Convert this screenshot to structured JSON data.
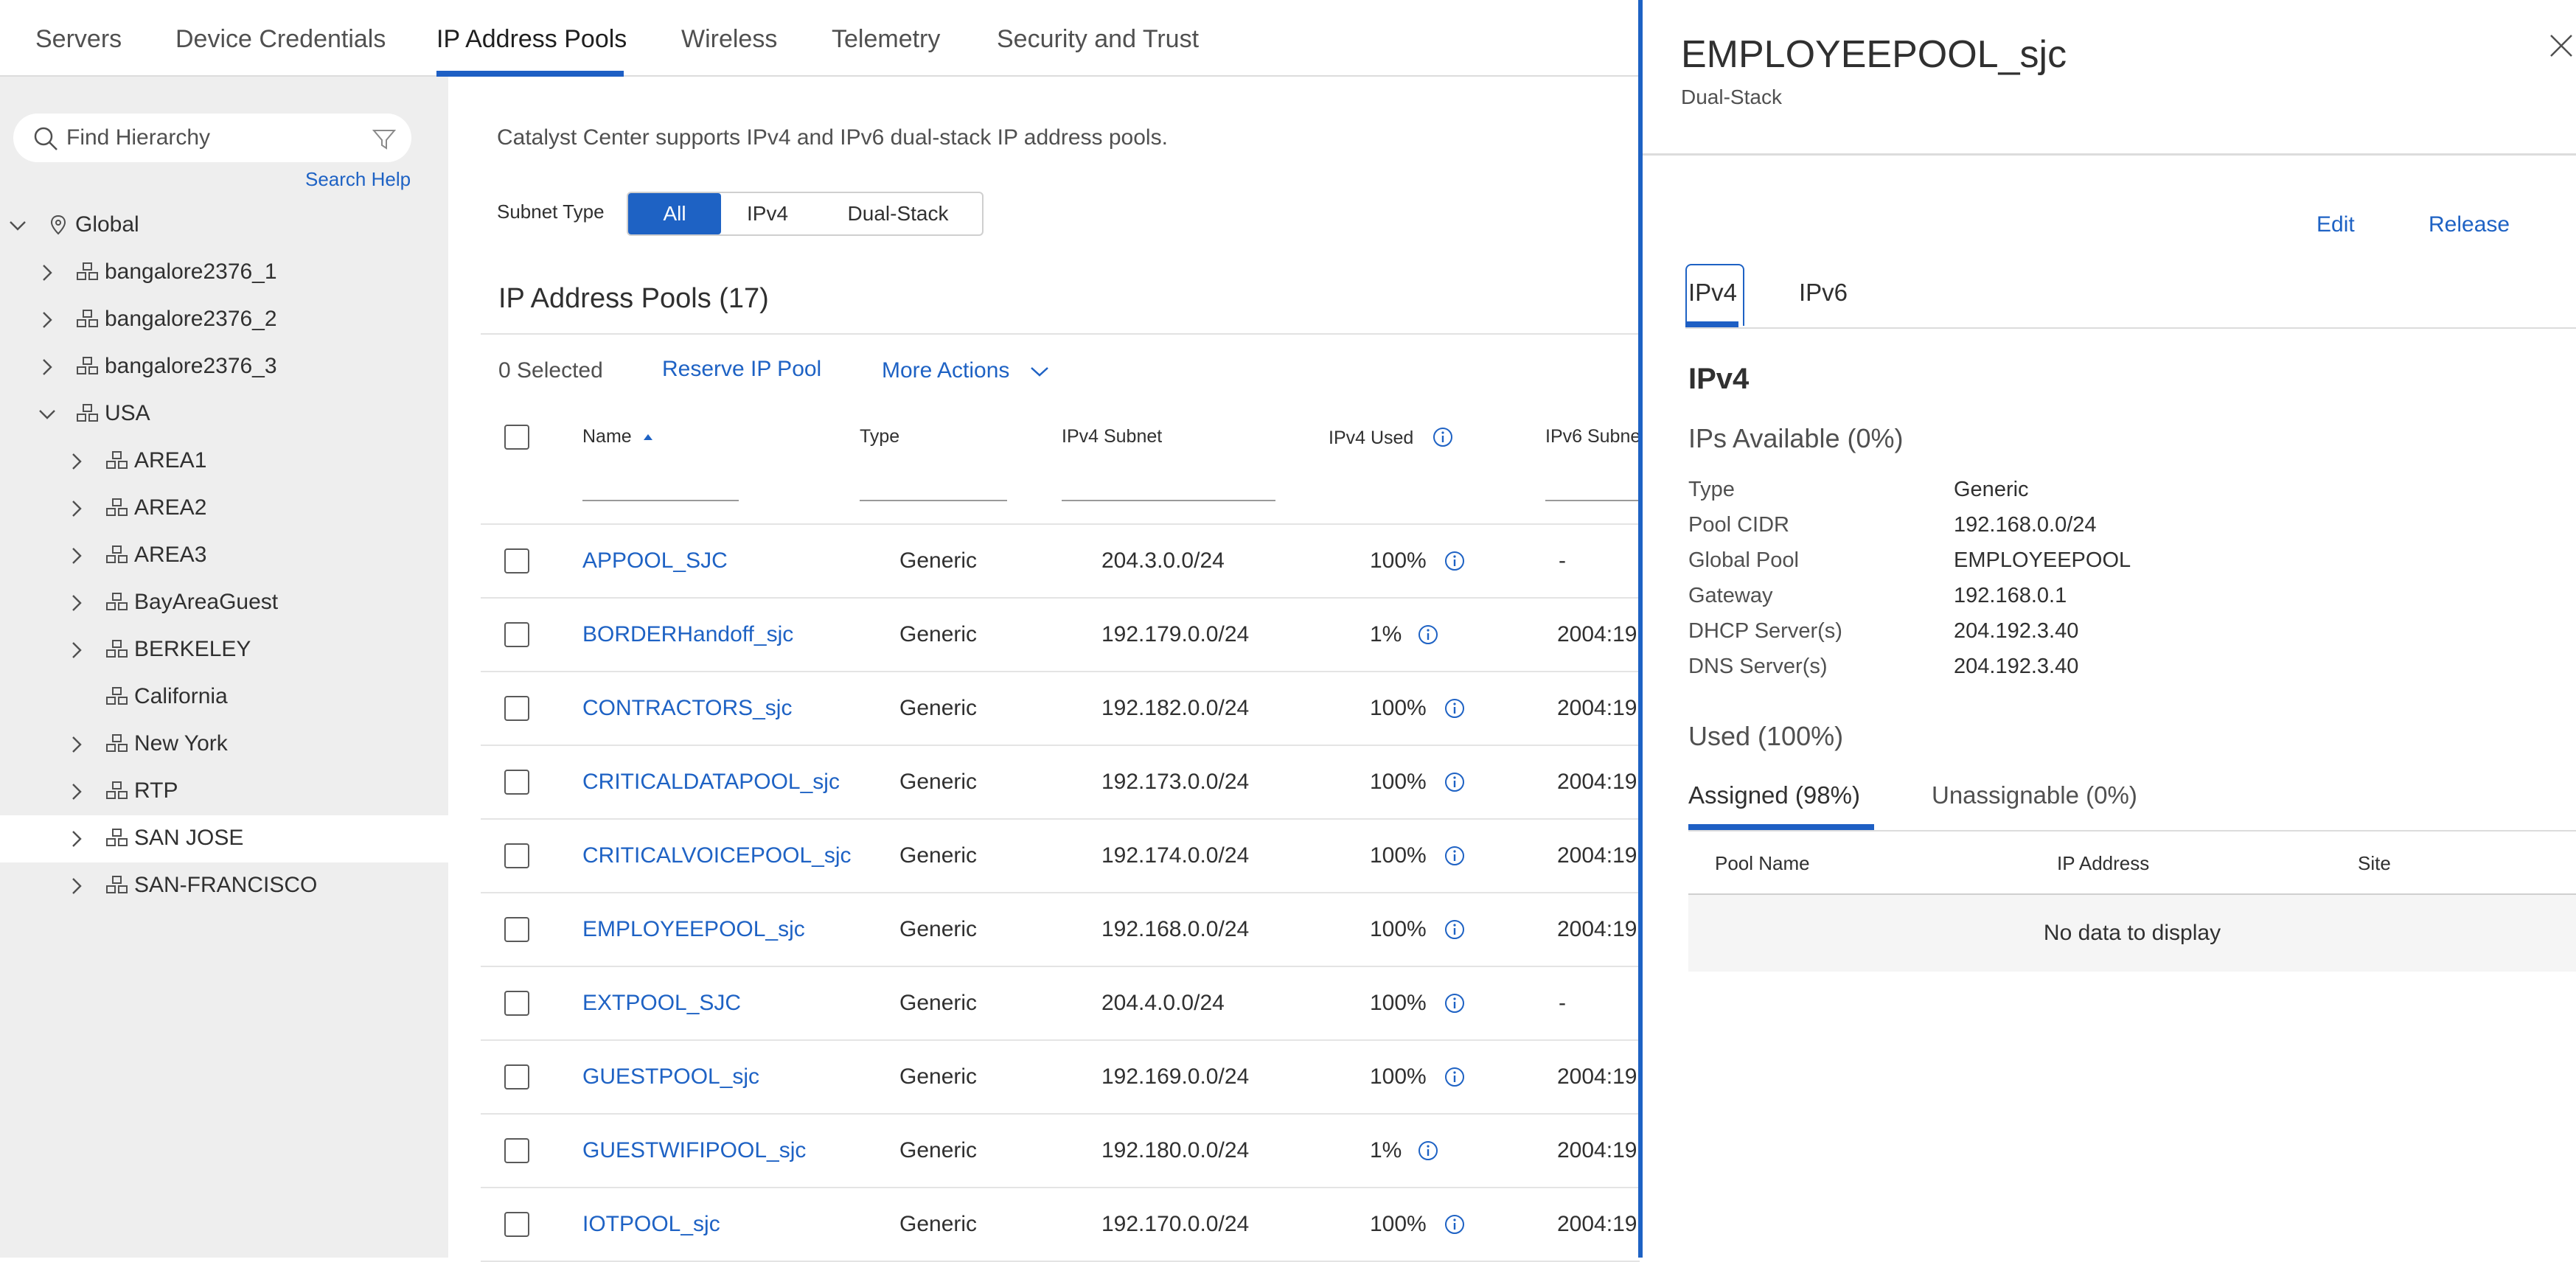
{
  "top_tabs": [
    "Servers",
    "Device Credentials",
    "IP Address Pools",
    "Wireless",
    "Telemetry",
    "Security and Trust"
  ],
  "active_tab": "IP Address Pools",
  "sidebar": {
    "search_placeholder": "Find Hierarchy",
    "search_help": "Search Help",
    "tree": [
      {
        "label": "Global",
        "level": 0,
        "expanded": true
      },
      {
        "label": "bangalore2376_1",
        "level": 1
      },
      {
        "label": "bangalore2376_2",
        "level": 1
      },
      {
        "label": "bangalore2376_3",
        "level": 1
      },
      {
        "label": "USA",
        "level": 1,
        "expanded": true
      },
      {
        "label": "AREA1",
        "level": 2
      },
      {
        "label": "AREA2",
        "level": 2
      },
      {
        "label": "AREA3",
        "level": 2
      },
      {
        "label": "BayAreaGuest",
        "level": 2
      },
      {
        "label": "BERKELEY",
        "level": 2
      },
      {
        "label": "California",
        "level": 2
      },
      {
        "label": "New York",
        "level": 2
      },
      {
        "label": "RTP",
        "level": 2
      },
      {
        "label": "SAN JOSE",
        "level": 2,
        "selected": true
      },
      {
        "label": "SAN-FRANCISCO",
        "level": 2
      }
    ]
  },
  "main": {
    "intro": "Catalyst Center supports IPv4 and IPv6 dual-stack IP address pools.",
    "subnet_type_label": "Subnet Type",
    "subnet_options": [
      "All",
      "IPv4",
      "Dual-Stack"
    ],
    "pools_title": "IP Address Pools (17)",
    "selected_count": "0 Selected",
    "reserve_label": "Reserve IP Pool",
    "more_actions_label": "More Actions",
    "columns": [
      "Name",
      "Type",
      "IPv4 Subnet",
      "IPv4 Used",
      "IPv6 Subne"
    ],
    "rows": [
      {
        "name": "APPOOL_SJC",
        "type": "Generic",
        "subnet": "204.3.0.0/24",
        "used": "100%",
        "ipv6": "-"
      },
      {
        "name": "BORDERHandoff_sjc",
        "type": "Generic",
        "subnet": "192.179.0.0/24",
        "used": "1%",
        "ipv6": "2004:19"
      },
      {
        "name": "CONTRACTORS_sjc",
        "type": "Generic",
        "subnet": "192.182.0.0/24",
        "used": "100%",
        "ipv6": "2004:19"
      },
      {
        "name": "CRITICALDATAPOOL_sjc",
        "type": "Generic",
        "subnet": "192.173.0.0/24",
        "used": "100%",
        "ipv6": "2004:19"
      },
      {
        "name": "CRITICALVOICEPOOL_sjc",
        "type": "Generic",
        "subnet": "192.174.0.0/24",
        "used": "100%",
        "ipv6": "2004:19"
      },
      {
        "name": "EMPLOYEEPOOL_sjc",
        "type": "Generic",
        "subnet": "192.168.0.0/24",
        "used": "100%",
        "ipv6": "2004:19"
      },
      {
        "name": "EXTPOOL_SJC",
        "type": "Generic",
        "subnet": "204.4.0.0/24",
        "used": "100%",
        "ipv6": "-"
      },
      {
        "name": "GUESTPOOL_sjc",
        "type": "Generic",
        "subnet": "192.169.0.0/24",
        "used": "100%",
        "ipv6": "2004:19"
      },
      {
        "name": "GUESTWIFIPOOL_sjc",
        "type": "Generic",
        "subnet": "192.180.0.0/24",
        "used": "1%",
        "ipv6": "2004:19"
      },
      {
        "name": "IOTPOOL_sjc",
        "type": "Generic",
        "subnet": "192.170.0.0/24",
        "used": "100%",
        "ipv6": "2004:19"
      }
    ]
  },
  "drawer": {
    "title": "EMPLOYEEPOOL_sjc",
    "subtitle": "Dual-Stack",
    "edit_label": "Edit",
    "release_label": "Release",
    "tabs": [
      "IPv4",
      "IPv6"
    ],
    "section_title": "IPv4",
    "available": "IPs Available (0%)",
    "details": [
      {
        "k": "Type",
        "v": "Generic"
      },
      {
        "k": "Pool CIDR",
        "v": "192.168.0.0/24"
      },
      {
        "k": "Global Pool",
        "v": "EMPLOYEEPOOL"
      },
      {
        "k": "Gateway",
        "v": "192.168.0.1"
      },
      {
        "k": "DHCP Server(s)",
        "v": "204.192.3.40"
      },
      {
        "k": "DNS Server(s)",
        "v": "204.192.3.40"
      }
    ],
    "used": "Used (100%)",
    "sub_tabs": [
      "Assigned (98%)",
      "Unassignable (0%)"
    ],
    "table_columns": [
      "Pool Name",
      "IP Address",
      "Site"
    ],
    "empty_text": "No data to display"
  },
  "colors": {
    "accent": "#1e62c4",
    "sidebar_bg": "#eeeeee",
    "link": "#1e62c4"
  }
}
